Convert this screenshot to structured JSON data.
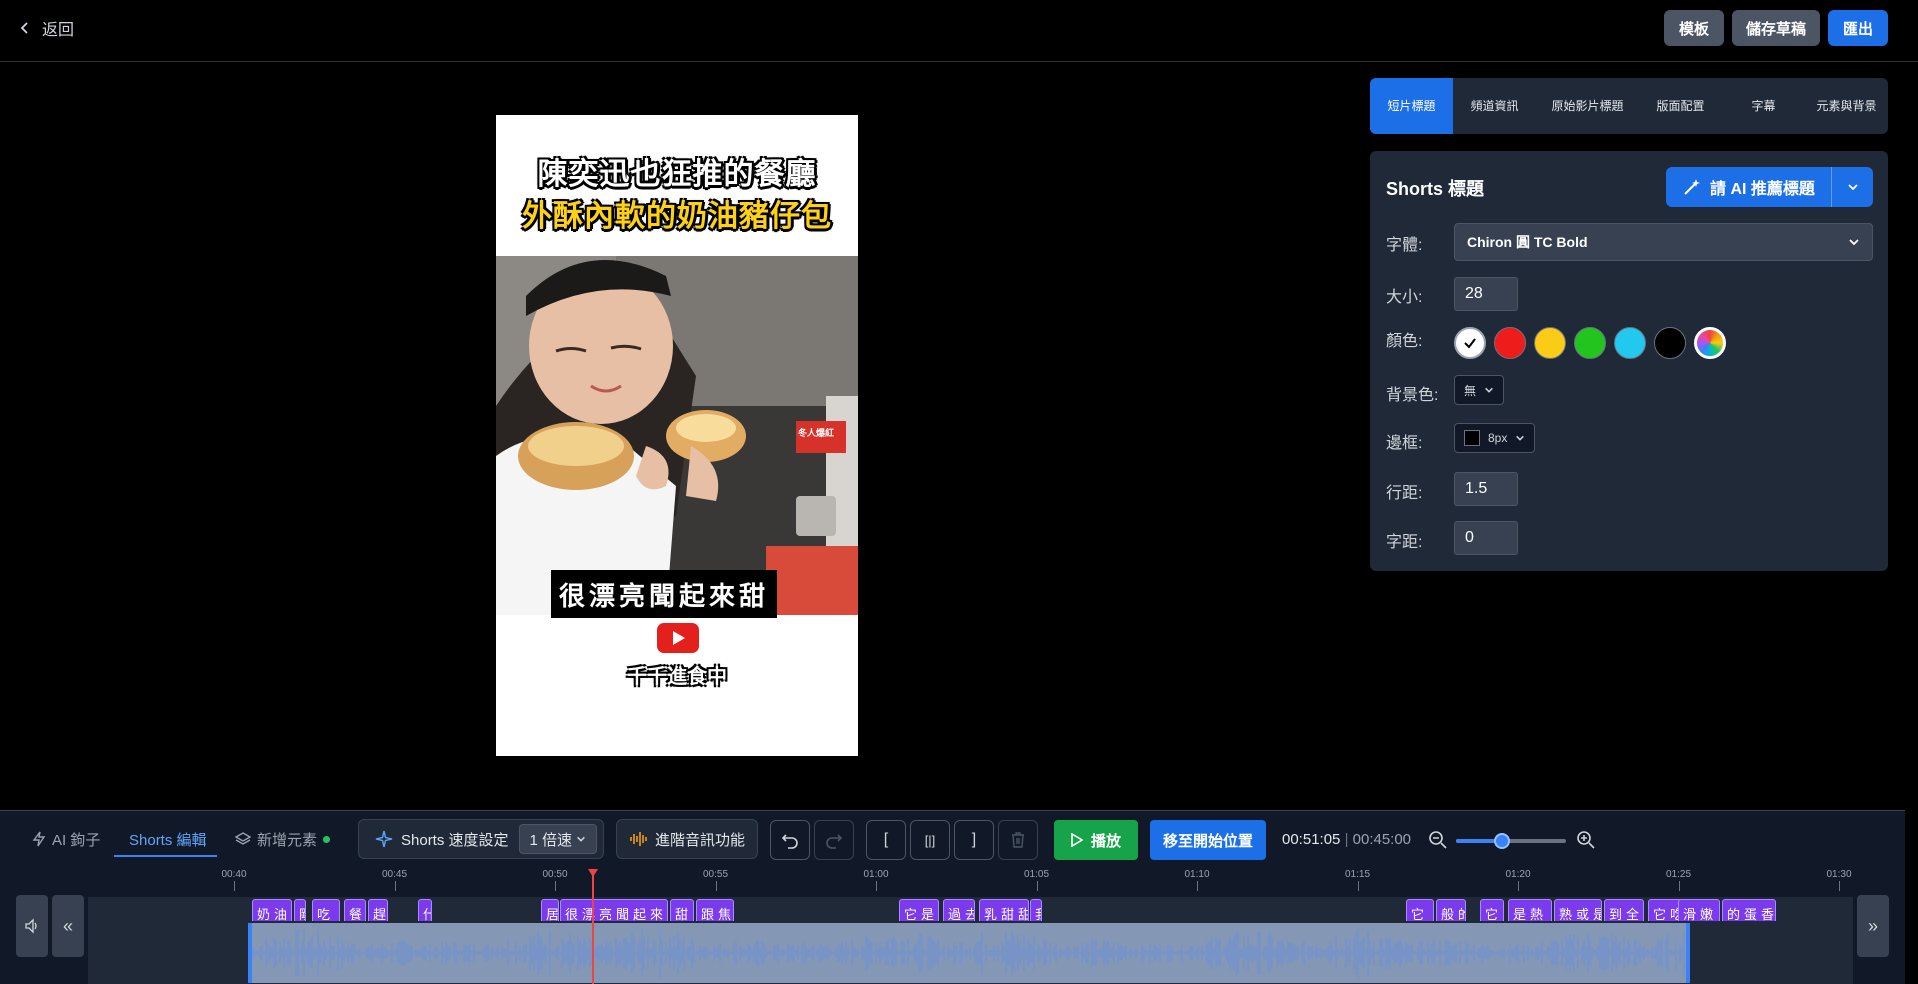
{
  "topbar": {
    "back_label": "返回",
    "template_label": "模板",
    "save_draft_label": "儲存草稿",
    "export_label": "匯出"
  },
  "preview": {
    "title_line1": "陳奕迅也狂推的餐廳",
    "title_line2": "外酥內軟的奶油豬仔包",
    "subtitle": "很漂亮聞起來甜",
    "channel": "千千進食中",
    "sign_text": "冬人爆紅"
  },
  "tabs": [
    {
      "label": "短片標題",
      "active": true
    },
    {
      "label": "頻道資訊",
      "active": false
    },
    {
      "label": "原始影片標題",
      "active": false
    },
    {
      "label": "版面配置",
      "active": false
    },
    {
      "label": "字幕",
      "active": false
    },
    {
      "label": "元素與背景",
      "active": false
    }
  ],
  "panel": {
    "title": "Shorts 標題",
    "ai_button": "請 AI 推薦標題",
    "font_label": "字體:",
    "font_value": "Chiron 圓 TC Bold",
    "size_label": "大小:",
    "size_value": "28",
    "color_label": "顏色:",
    "colors": [
      "#ffffff",
      "#ef1c1c",
      "#facc15",
      "#22c51e",
      "#22c8ee",
      "#000000"
    ],
    "bg_label": "背景色:",
    "bg_value": "無",
    "border_label": "邊框:",
    "border_value": "8px",
    "line_height_label": "行距:",
    "line_height_value": "1.5",
    "letter_spacing_label": "字距:",
    "letter_spacing_value": "0"
  },
  "bottom": {
    "tab_ai_hook": "AI 鉤子",
    "tab_shorts_edit": "Shorts 編輯",
    "tab_add_element": "新增元素",
    "speed_label": "Shorts 速度設定",
    "speed_value": "1 倍速",
    "audio_feature": "進階音訊功能",
    "bracket_open": "[",
    "bracket_split": "[|]",
    "bracket_close": "]",
    "play_label": "播放",
    "goto_start_label": "移至開始位置",
    "current_time": "00:51:05",
    "total_time": "00:45:00",
    "zoom_level": 0.42
  },
  "timeline": {
    "ticks": [
      "00:40",
      "00:45",
      "00:50",
      "00:55",
      "01:00",
      "01:05",
      "01:10",
      "01:15",
      "01:20",
      "01:25",
      "01:30"
    ],
    "clips": [
      {
        "text": "奶油豬"
      },
      {
        "text": "剛"
      },
      {
        "text": "吃"
      },
      {
        "text": "餐"
      },
      {
        "text": "趕"
      },
      {
        "text": "什"
      },
      {
        "text": "居"
      },
      {
        "text": "很漂亮聞起來"
      },
      {
        "text": "甜"
      },
      {
        "text": "跟焦"
      },
      {
        "text": "它是"
      },
      {
        "text": "過去"
      },
      {
        "text": "乳甜甜"
      },
      {
        "text": "我"
      },
      {
        "text": "它"
      },
      {
        "text": "般的"
      },
      {
        "text": "它"
      },
      {
        "text": "是熱"
      },
      {
        "text": "熟或是"
      },
      {
        "text": "到全"
      },
      {
        "text": "它吃"
      },
      {
        "text": "滑嫩"
      },
      {
        "text": "的蛋香"
      }
    ]
  }
}
